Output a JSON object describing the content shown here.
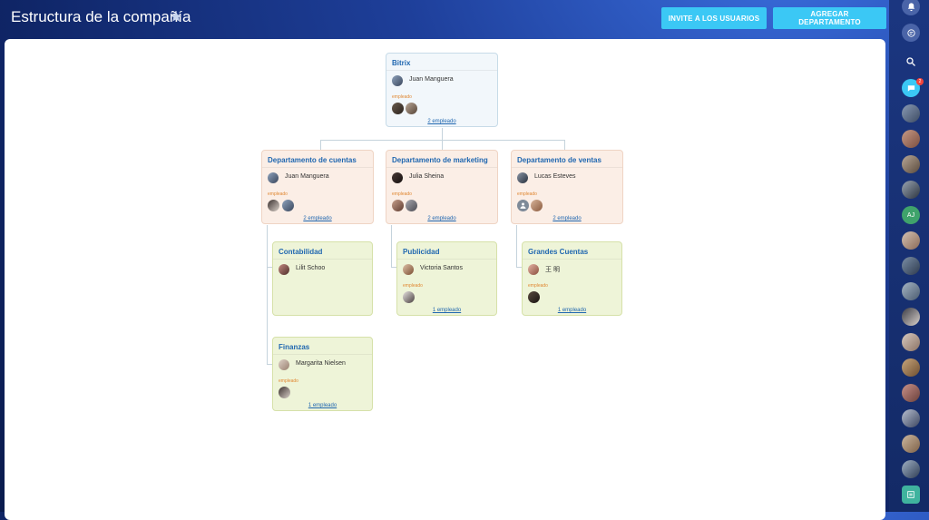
{
  "header": {
    "title": "Estructura de la compañía",
    "invite_label": "INVITE A LOS USUARIOS",
    "add_dept_label": "AGREGAR DEPARTAMENTO"
  },
  "org": {
    "root": {
      "title": "Bitrix",
      "head": "Juan Manguera",
      "employees_label": "empleado",
      "count": "2 empleado"
    },
    "depts": [
      {
        "title": "Departamento de cuentas",
        "head": "Juan Manguera",
        "employees_label": "empleado",
        "count": "2 empleado"
      },
      {
        "title": "Departamento de marketing",
        "head": "Julia Sheina",
        "employees_label": "empleado",
        "count": "2 empleado"
      },
      {
        "title": "Departamento de ventas",
        "head": "Lucas Esteves",
        "employees_label": "empleado",
        "count": "2 empleado"
      }
    ],
    "subs": [
      {
        "title": "Contabilidad",
        "head": "Lilit Schoo"
      },
      {
        "title": "Finanzas",
        "head": "Margarita Nielsen",
        "employees_label": "empleado",
        "count": "1 empleado"
      },
      {
        "title": "Publicidad",
        "head": "Victoria Santos",
        "employees_label": "empleado",
        "count": "1 empleado"
      },
      {
        "title": "Grandes Cuentas",
        "head": "王 明",
        "employees_label": "empleado",
        "count": "1 empleado"
      }
    ]
  },
  "sidebar": {
    "chat_badge": "2",
    "initials_avatar": "AJ"
  },
  "colors": {
    "accent": "#3bc8f5",
    "title_blue": "#2067b0",
    "employee_orange": "#e08833"
  }
}
